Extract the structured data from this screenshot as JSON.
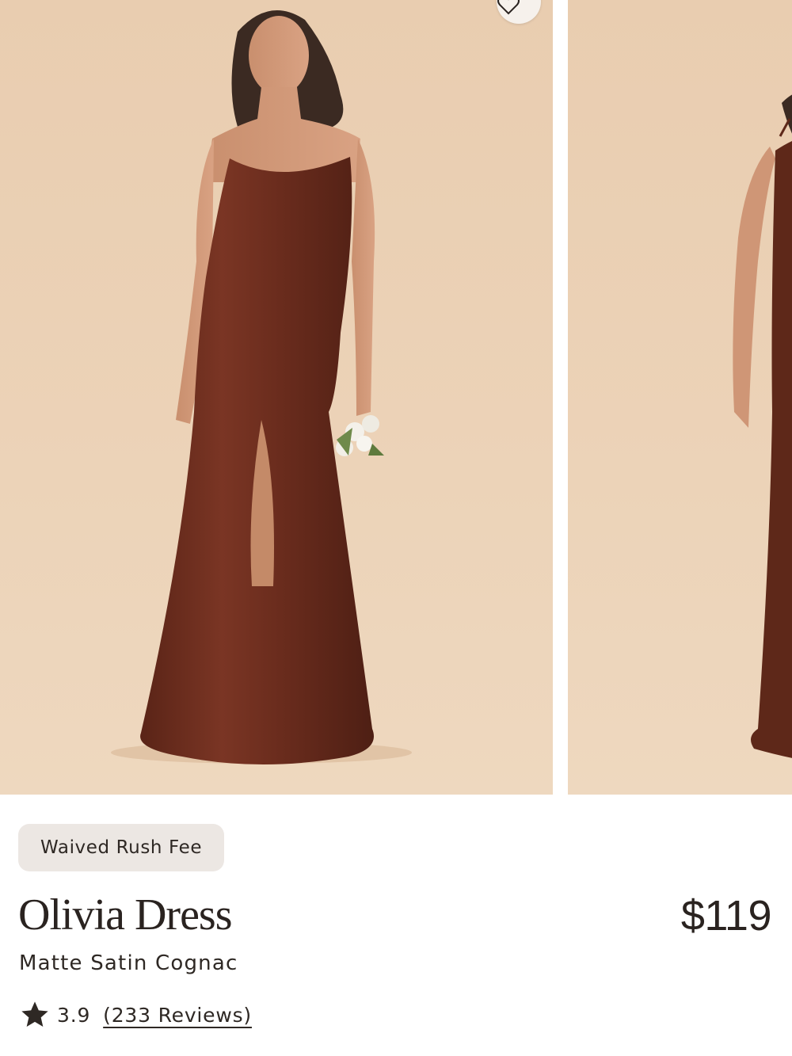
{
  "gallery": {
    "images": [
      {
        "alt": "Olivia Dress in Matte Satin Cognac, front view"
      },
      {
        "alt": "Olivia Dress in Matte Satin Cognac, back view"
      }
    ],
    "favorite_icon": "heart-icon"
  },
  "product": {
    "badge": "Waived Rush Fee",
    "name": "Olivia Dress",
    "variant": "Matte Satin Cognac",
    "price": "$119",
    "rating": {
      "icon": "star-icon",
      "score": "3.9",
      "reviews_label": "(233 Reviews)"
    }
  },
  "colors": {
    "background": "#ffffff",
    "photo_backdrop": "#ebd1b6",
    "dress": "#6e2e1f",
    "text": "#2a2320",
    "badge_bg": "#ece7e3"
  }
}
